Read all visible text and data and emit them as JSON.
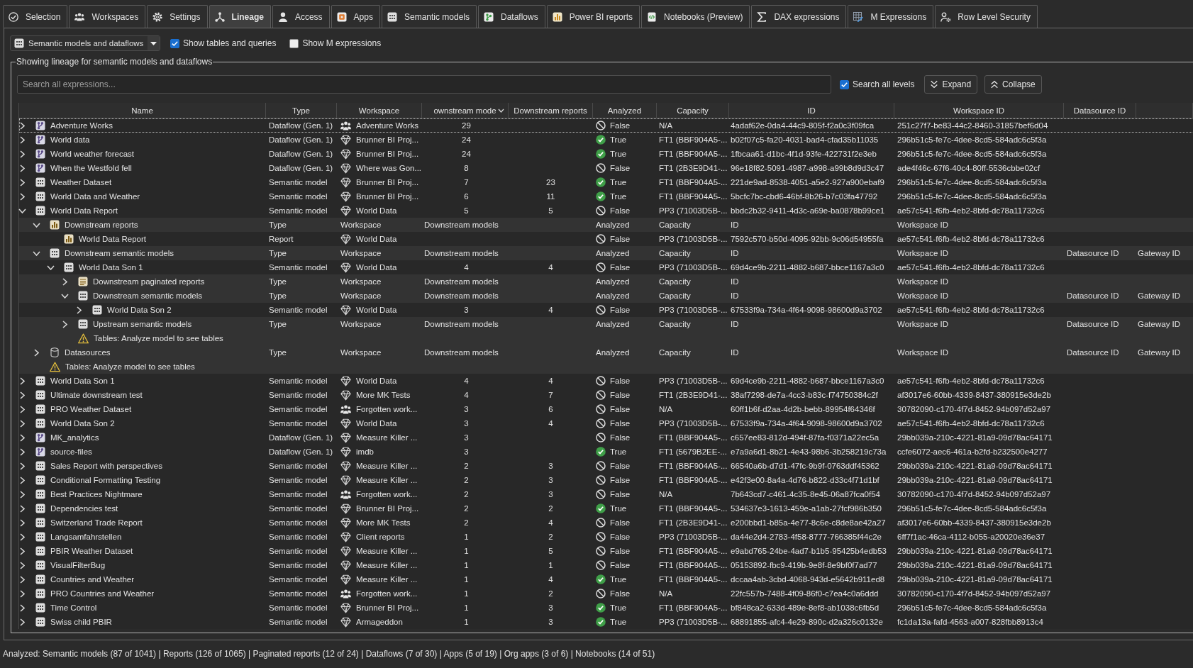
{
  "tabs": [
    {
      "label": "Selection",
      "selected": false
    },
    {
      "label": "Workspaces",
      "selected": false
    },
    {
      "label": "Settings",
      "selected": false
    },
    {
      "label": "Lineage",
      "selected": true
    },
    {
      "label": "Access",
      "selected": false
    },
    {
      "label": "Apps",
      "selected": false
    },
    {
      "label": "Semantic models",
      "selected": false
    },
    {
      "label": "Dataflows",
      "selected": false
    },
    {
      "label": "Power BI reports",
      "selected": false
    },
    {
      "label": "Notebooks (Preview)",
      "selected": false
    },
    {
      "label": "DAX expressions",
      "selected": false
    },
    {
      "label": "M Expressions",
      "selected": false
    },
    {
      "label": "Row Level Security",
      "selected": false
    }
  ],
  "toolbar": {
    "view": "Semantic models and dataflows",
    "options": [
      {
        "label": "Show tables and queries",
        "checked": true
      },
      {
        "label": "Show M expressions",
        "checked": false
      }
    ]
  },
  "lineage": {
    "title": "Showing lineage for semantic models and dataflows",
    "search": {
      "placeholder": "Search all expressions..."
    },
    "search_all_levels": {
      "label": "Search all levels",
      "checked": true
    },
    "buttons": [
      "Expand",
      "Collapse"
    ],
    "table": {
      "columns": [
        {
          "label": "Name",
          "sorted": false
        },
        {
          "label": "Type",
          "sorted": false
        },
        {
          "label": "Workspace",
          "sorted": false
        },
        {
          "label": "ownstream mode",
          "sorted": true
        },
        {
          "label": "Downstream reports",
          "sorted": false
        },
        {
          "label": "Analyzed",
          "sorted": false
        },
        {
          "label": "Capacity",
          "sorted": false
        },
        {
          "label": "ID",
          "sorted": false
        },
        {
          "label": "Workspace ID",
          "sorted": false
        },
        {
          "label": "Datasource ID",
          "sorted": false
        }
      ],
      "rows": [
        {
          "kind": "dataflow",
          "name": "Adventure Works",
          "type": "Dataflow (Gen. 1)",
          "workspace": {
            "text": "Adventure Works",
            "kind": "shared"
          },
          "downstream_models": "29",
          "analyzed": "False",
          "is_analyzed": false,
          "capacity": "N/A",
          "id": "4adaf62e-0da4-44c9-805f-f2a0c3f09fca",
          "workspace_id": "251c27f7-be83-44c2-8460-31857bef6d04",
          "selected": true,
          "expanded": false
        },
        {
          "kind": "dataflow",
          "name": "World data",
          "type": "Dataflow (Gen. 1)",
          "workspace": {
            "text": "Brunner BI Proj...",
            "kind": "premium"
          },
          "downstream_models": "24",
          "analyzed": "True",
          "is_analyzed": true,
          "capacity": "FT1 (BBF904A5-...",
          "id": "b02f07c5-fa20-4031-bad4-cfad35b11035",
          "workspace_id": "296b51c5-fe7c-4dee-8cd5-584adc6c5f3a",
          "selected": false,
          "expanded": false
        },
        {
          "kind": "dataflow",
          "name": "World weather forecast",
          "type": "Dataflow (Gen. 1)",
          "workspace": {
            "text": "Brunner BI Proj...",
            "kind": "premium"
          },
          "downstream_models": "24",
          "analyzed": "True",
          "is_analyzed": true,
          "capacity": "FT1 (BBF904A5-...",
          "id": "1fbcaa61-d1bc-4f1d-93fe-422731f2e3eb",
          "workspace_id": "296b51c5-fe7c-4dee-8cd5-584adc6c5f3a",
          "selected": false,
          "expanded": false
        },
        {
          "kind": "dataflow",
          "name": "When the Westfold fell",
          "type": "Dataflow (Gen. 1)",
          "workspace": {
            "text": "Where was Gon...",
            "kind": "premium"
          },
          "downstream_models": "8",
          "analyzed": "False",
          "is_analyzed": false,
          "capacity": "FT1 (2B3E9D41-...",
          "id": "96e18f82-5091-4987-a998-a99b8d9d3c47",
          "workspace_id": "ade4f46c-67f6-40c4-80ff-5536cbbe02cf",
          "selected": false,
          "expanded": false
        },
        {
          "kind": "model",
          "name": "Weather Dataset",
          "type": "Semantic model",
          "workspace": {
            "text": "Brunner BI Proj...",
            "kind": "premium"
          },
          "downstream_models": "7",
          "downstream_reports": "23",
          "analyzed": "True",
          "is_analyzed": true,
          "capacity": "FT1 (BBF904A5-...",
          "id": "221de9ad-8538-4051-a5e2-927a900ebaf9",
          "workspace_id": "296b51c5-fe7c-4dee-8cd5-584adc6c5f3a",
          "selected": false,
          "expanded": false
        },
        {
          "kind": "model",
          "name": "World Data and Weather",
          "type": "Semantic model",
          "workspace": {
            "text": "Brunner BI Proj...",
            "kind": "premium"
          },
          "downstream_models": "6",
          "downstream_reports": "11",
          "analyzed": "True",
          "is_analyzed": true,
          "capacity": "FT1 (BBF904A5-...",
          "id": "5bcfc7bc-cbd6-46bf-8b26-b7c03fa47792",
          "workspace_id": "296b51c5-fe7c-4dee-8cd5-584adc6c5f3a",
          "selected": false,
          "expanded": false
        },
        {
          "kind": "model",
          "name": "World Data Report",
          "type": "Semantic model",
          "workspace": {
            "text": "World Data",
            "kind": "premium"
          },
          "downstream_models": "5",
          "downstream_reports": "5",
          "analyzed": "False",
          "is_analyzed": false,
          "capacity": "PP3 (71003D5B-...",
          "id": "bbdc2b32-9411-4d3c-a69e-ba0878b99ce1",
          "workspace_id": "ae57c541-f6fb-4eb2-8bfd-dc78a11732c6",
          "selected": false,
          "expanded": true,
          "children": [
            {
              "kind": "reportgroup",
              "name": "Downstream reports",
              "type": "Type",
              "workspace": {
                "text": "Workspace"
              },
              "downstream_models": "Downstream models",
              "analyzed": "Analyzed",
              "capacity": "Capacity",
              "id": "ID",
              "workspace_id": "Workspace ID",
              "selected": false,
              "expanded": true,
              "children": [
                {
                  "kind": "report",
                  "name": "World Data Report",
                  "type": "Report",
                  "workspace": {
                    "text": "World Data",
                    "kind": "premium"
                  },
                  "analyzed": "False",
                  "is_analyzed": false,
                  "capacity": "PP3 (71003D5B-...",
                  "id": "7592c570-b50d-4095-92bb-9c06d54955fa",
                  "workspace_id": "ae57c541-f6fb-4eb2-8bfd-dc78a11732c6",
                  "selected": false
                }
              ]
            },
            {
              "kind": "modelgroup",
              "name": "Downstream semantic models",
              "type": "Type",
              "workspace": {
                "text": "Workspace"
              },
              "downstream_models": "Downstream models",
              "analyzed": "Analyzed",
              "capacity": "Capacity",
              "id": "ID",
              "workspace_id": "Workspace ID",
              "datasource_id": "Datasource ID",
              "gateway_id": "Gateway ID",
              "selected": false,
              "expanded": true,
              "children": [
                {
                  "kind": "model",
                  "name": "World Data Son 1",
                  "type": "Semantic model",
                  "workspace": {
                    "text": "World Data",
                    "kind": "premium"
                  },
                  "downstream_models": "4",
                  "downstream_reports": "4",
                  "analyzed": "False",
                  "is_analyzed": false,
                  "capacity": "PP3 (71003D5B-...",
                  "id": "69d4ce9b-2211-4882-b687-bbce1167a3c0",
                  "workspace_id": "ae57c541-f6fb-4eb2-8bfd-dc78a11732c6",
                  "selected": false,
                  "expanded": true,
                  "children": [
                    {
                      "kind": "paginatedgroup",
                      "name": "Downstream paginated reports",
                      "type": "Type",
                      "workspace": {
                        "text": "Workspace"
                      },
                      "downstream_models": "Downstream models",
                      "analyzed": "Analyzed",
                      "capacity": "Capacity",
                      "id": "ID",
                      "workspace_id": "Workspace ID",
                      "selected": false,
                      "expanded": false
                    },
                    {
                      "kind": "modelgroup",
                      "name": "Downstream semantic models",
                      "type": "Type",
                      "workspace": {
                        "text": "Workspace"
                      },
                      "downstream_models": "Downstream models",
                      "analyzed": "Analyzed",
                      "capacity": "Capacity",
                      "id": "ID",
                      "workspace_id": "Workspace ID",
                      "datasource_id": "Datasource ID",
                      "gateway_id": "Gateway ID",
                      "selected": false,
                      "expanded": true,
                      "children": [
                        {
                          "kind": "model",
                          "name": "World Data Son 2",
                          "type": "Semantic model",
                          "workspace": {
                            "text": "World Data",
                            "kind": "premium"
                          },
                          "downstream_models": "3",
                          "downstream_reports": "4",
                          "analyzed": "False",
                          "is_analyzed": false,
                          "capacity": "PP3 (71003D5B-...",
                          "id": "67533f9a-734a-4f64-9098-98600d9a3702",
                          "workspace_id": "ae57c541-f6fb-4eb2-8bfd-dc78a11732c6",
                          "selected": false,
                          "expanded": false
                        }
                      ]
                    },
                    {
                      "kind": "modelgroup",
                      "name": "Upstream semantic models",
                      "type": "Type",
                      "workspace": {
                        "text": "Workspace"
                      },
                      "downstream_models": "Downstream models",
                      "analyzed": "Analyzed",
                      "capacity": "Capacity",
                      "id": "ID",
                      "workspace_id": "Workspace ID",
                      "datasource_id": "Datasource ID",
                      "gateway_id": "Gateway ID",
                      "selected": false,
                      "expanded": false
                    },
                    {
                      "kind": "note",
                      "name": "Tables: Analyze model to see tables",
                      "selected": false
                    }
                  ]
                }
              ]
            },
            {
              "kind": "sourcegroup",
              "name": "Datasources",
              "type": "Type",
              "workspace": {
                "text": "Workspace"
              },
              "downstream_models": "Downstream models",
              "analyzed": "Analyzed",
              "capacity": "Capacity",
              "id": "ID",
              "workspace_id": "Workspace ID",
              "datasource_id": "Datasource ID",
              "gateway_id": "Gateway ID",
              "selected": false,
              "expanded": false
            },
            {
              "kind": "note",
              "name": "Tables: Analyze model to see tables",
              "selected": false
            }
          ]
        },
        {
          "kind": "model",
          "name": "World Data Son 1",
          "type": "Semantic model",
          "workspace": {
            "text": "World Data",
            "kind": "premium"
          },
          "downstream_models": "4",
          "downstream_reports": "4",
          "analyzed": "False",
          "is_analyzed": false,
          "capacity": "PP3 (71003D5B-...",
          "id": "69d4ce9b-2211-4882-b687-bbce1167a3c0",
          "workspace_id": "ae57c541-f6fb-4eb2-8bfd-dc78a11732c6",
          "selected": false,
          "expanded": false
        },
        {
          "kind": "model",
          "name": "Ultimate downstream test",
          "type": "Semantic model",
          "workspace": {
            "text": "More MK Tests",
            "kind": "premium"
          },
          "downstream_models": "4",
          "downstream_reports": "7",
          "analyzed": "False",
          "is_analyzed": false,
          "capacity": "FT1 (2B3E9D41-...",
          "id": "38af7298-de7a-4cc3-b83c-f74750384c2f",
          "workspace_id": "af3017e6-60bb-4339-8437-380915e3de2b",
          "selected": false,
          "expanded": false
        },
        {
          "kind": "model",
          "name": "PRO Weather Dataset",
          "type": "Semantic model",
          "workspace": {
            "text": "Forgotten work...",
            "kind": "shared"
          },
          "downstream_models": "3",
          "downstream_reports": "6",
          "analyzed": "False",
          "is_analyzed": false,
          "capacity": "N/A",
          "id": "60ff1b6f-d2aa-4d2b-bebb-89954f64346f",
          "workspace_id": "30782090-c170-4f7d-8452-94b097d52a97",
          "selected": false,
          "expanded": false
        },
        {
          "kind": "model",
          "name": "World Data Son 2",
          "type": "Semantic model",
          "workspace": {
            "text": "World Data",
            "kind": "premium"
          },
          "downstream_models": "3",
          "downstream_reports": "4",
          "analyzed": "False",
          "is_analyzed": false,
          "capacity": "PP3 (71003D5B-...",
          "id": "67533f9a-734a-4f64-9098-98600d9a3702",
          "workspace_id": "ae57c541-f6fb-4eb2-8bfd-dc78a11732c6",
          "selected": false,
          "expanded": false
        },
        {
          "kind": "dataflow",
          "name": "MK_analytics",
          "type": "Dataflow (Gen. 1)",
          "workspace": {
            "text": "Measure Killer ...",
            "kind": "premium"
          },
          "downstream_models": "3",
          "analyzed": "False",
          "is_analyzed": false,
          "capacity": "FT1 (BBF904A5-...",
          "id": "c657ee83-812d-494f-87fa-f0371a22ec5a",
          "workspace_id": "29bb039a-210c-4221-81a9-09d78ac64171",
          "selected": false,
          "expanded": false
        },
        {
          "kind": "dataflow",
          "name": "source-files",
          "type": "Dataflow (Gen. 1)",
          "workspace": {
            "text": "imdb",
            "kind": "premium"
          },
          "downstream_models": "3",
          "analyzed": "True",
          "is_analyzed": true,
          "capacity": "FT1 (5679B2EE-...",
          "id": "e7a9a6d1-8b21-4e43-98b6-3b258219c73a",
          "workspace_id": "ccfe6072-aec6-461a-b2fd-b232500e4277",
          "selected": false,
          "expanded": false
        },
        {
          "kind": "model",
          "name": "Sales Report with perspectives",
          "type": "Semantic model",
          "workspace": {
            "text": "Measure Killer ...",
            "kind": "premium"
          },
          "downstream_models": "2",
          "downstream_reports": "3",
          "analyzed": "False",
          "is_analyzed": false,
          "capacity": "FT1 (BBF904A5-...",
          "id": "66540a6b-d7d1-47fc-9b9f-0763ddf45362",
          "workspace_id": "29bb039a-210c-4221-81a9-09d78ac64171",
          "selected": false,
          "expanded": false
        },
        {
          "kind": "model",
          "name": "Conditional Formatting Testing",
          "type": "Semantic model",
          "workspace": {
            "text": "Measure Killer ...",
            "kind": "premium"
          },
          "downstream_models": "2",
          "downstream_reports": "3",
          "analyzed": "False",
          "is_analyzed": false,
          "capacity": "FT1 (BBF904A5-...",
          "id": "e42f3e00-8a4a-4d76-b822-d33c4f71d1bf",
          "workspace_id": "29bb039a-210c-4221-81a9-09d78ac64171",
          "selected": false,
          "expanded": false
        },
        {
          "kind": "model",
          "name": "Best Practices Nightmare",
          "type": "Semantic model",
          "workspace": {
            "text": "Forgotten work...",
            "kind": "shared"
          },
          "downstream_models": "2",
          "downstream_reports": "3",
          "analyzed": "False",
          "is_analyzed": false,
          "capacity": "N/A",
          "id": "7b643cd7-c461-4c35-8e45-06a87fca0f54",
          "workspace_id": "30782090-c170-4f7d-8452-94b097d52a97",
          "selected": false,
          "expanded": false
        },
        {
          "kind": "model",
          "name": "Dependencies test",
          "type": "Semantic model",
          "workspace": {
            "text": "Brunner BI Proj...",
            "kind": "premium"
          },
          "downstream_models": "2",
          "downstream_reports": "2",
          "analyzed": "True",
          "is_analyzed": true,
          "capacity": "FT1 (BBF904A5-...",
          "id": "534637e3-1613-459e-a1ab-27fcf986b350",
          "workspace_id": "296b51c5-fe7c-4dee-8cd5-584adc6c5f3a",
          "selected": false,
          "expanded": false
        },
        {
          "kind": "model",
          "name": "Switzerland Trade Report",
          "type": "Semantic model",
          "workspace": {
            "text": "More MK Tests",
            "kind": "premium"
          },
          "downstream_models": "2",
          "downstream_reports": "4",
          "analyzed": "False",
          "is_analyzed": false,
          "capacity": "FT1 (2B3E9D41-...",
          "id": "e200bbd1-b85a-4e77-8c6e-c8de8ae42a27",
          "workspace_id": "af3017e6-60bb-4339-8437-380915e3de2b",
          "selected": false,
          "expanded": false
        },
        {
          "kind": "model",
          "name": "Langsamfahrstellen",
          "type": "Semantic model",
          "workspace": {
            "text": "Client reports",
            "kind": "premium"
          },
          "downstream_models": "1",
          "downstream_reports": "2",
          "analyzed": "False",
          "is_analyzed": false,
          "capacity": "PP3 (71003D5B-...",
          "id": "da44e2d4-2783-4f58-8777-766385f44c2e",
          "workspace_id": "6ff7f1ac-46ca-4112-b055-a20020e36e37",
          "selected": false,
          "expanded": false
        },
        {
          "kind": "model",
          "name": "PBIR Weather Dataset",
          "type": "Semantic model",
          "workspace": {
            "text": "Measure Killer ...",
            "kind": "premium"
          },
          "downstream_models": "1",
          "downstream_reports": "5",
          "analyzed": "False",
          "is_analyzed": false,
          "capacity": "FT1 (BBF904A5-...",
          "id": "e9abd765-24be-4ad7-b1b5-95425b4edb53",
          "workspace_id": "29bb039a-210c-4221-81a9-09d78ac64171",
          "selected": false,
          "expanded": false
        },
        {
          "kind": "model",
          "name": "VisualFilterBug",
          "type": "Semantic model",
          "workspace": {
            "text": "Measure Killer ...",
            "kind": "premium"
          },
          "downstream_models": "1",
          "downstream_reports": "1",
          "analyzed": "False",
          "is_analyzed": false,
          "capacity": "FT1 (BBF904A5-...",
          "id": "05153892-fbc9-419b-9e8f-8e9bf0f7ad77",
          "workspace_id": "29bb039a-210c-4221-81a9-09d78ac64171",
          "selected": false,
          "expanded": false
        },
        {
          "kind": "model",
          "name": "Countries and Weather",
          "type": "Semantic model",
          "workspace": {
            "text": "Measure Killer ...",
            "kind": "premium"
          },
          "downstream_models": "1",
          "downstream_reports": "4",
          "analyzed": "True",
          "is_analyzed": true,
          "capacity": "FT1 (BBF904A5-...",
          "id": "dccaa4ab-3cbd-4068-943d-e5642b911ed8",
          "workspace_id": "29bb039a-210c-4221-81a9-09d78ac64171",
          "selected": false,
          "expanded": false
        },
        {
          "kind": "model",
          "name": "PRO Countries and Weather",
          "type": "Semantic model",
          "workspace": {
            "text": "Forgotten work...",
            "kind": "shared"
          },
          "downstream_models": "1",
          "downstream_reports": "2",
          "analyzed": "False",
          "is_analyzed": false,
          "capacity": "N/A",
          "id": "22fc557b-7488-4f09-86f0-c7ea4c0a6ddd",
          "workspace_id": "30782090-c170-4f7d-8452-94b097d52a97",
          "selected": false,
          "expanded": false
        },
        {
          "kind": "model",
          "name": "Time Control",
          "type": "Semantic model",
          "workspace": {
            "text": "Brunner BI Proj...",
            "kind": "premium"
          },
          "downstream_models": "1",
          "downstream_reports": "3",
          "analyzed": "True",
          "is_analyzed": true,
          "capacity": "FT1 (BBF904A5-...",
          "id": "bf848ca2-633d-489e-8ef8-ab1038c6fb5d",
          "workspace_id": "296b51c5-fe7c-4dee-8cd5-584adc6c5f3a",
          "selected": false,
          "expanded": false
        },
        {
          "kind": "model",
          "name": "Swiss child PBIR",
          "type": "Semantic model",
          "workspace": {
            "text": "Armageddon",
            "kind": "premium"
          },
          "downstream_models": "1",
          "downstream_reports": "3",
          "analyzed": "True",
          "is_analyzed": true,
          "capacity": "PP3 (71003D5B-...",
          "id": "68891855-afc4-4e29-890c-d2a326c0132e",
          "workspace_id": "fc1da13a-fafd-4563-a007-828fbb8913c4",
          "selected": false,
          "expanded": false
        }
      ]
    }
  },
  "status_bar": "Analyzed: Semantic models (87 of 1041)  |  Reports (126 of 1065)  |  Paginated reports (12 of 24)  |  Dataflows (7 of 30)  |  Apps (5 of 19)  |  Org apps (3 of 6)  |  Notebooks (14 of 51)"
}
